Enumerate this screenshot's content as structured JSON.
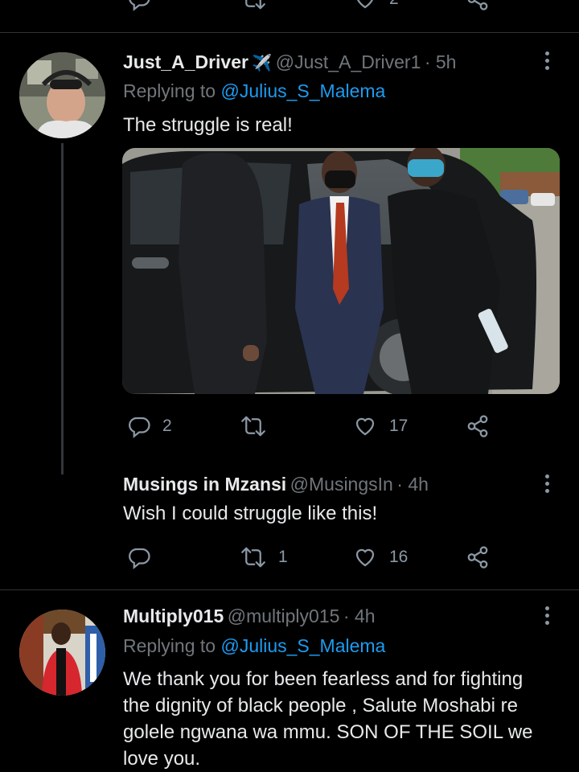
{
  "top_actions": {
    "likes": "2"
  },
  "tweet1": {
    "display_name": "Just_A_Driver",
    "badge": "✈️",
    "handle": "@Just_A_Driver1",
    "time": "· 5h",
    "replying_prefix": "Replying to",
    "replying_to": "@Julius_S_Malema",
    "text": "The struggle is real!",
    "replies": "2",
    "retweets": "",
    "likes": "17"
  },
  "tweet2": {
    "display_name": "Musings in Mzansi",
    "handle": "@MusingsIn",
    "time": "· 4h",
    "text": "Wish I could struggle like this!",
    "replies": "",
    "retweets": "1",
    "likes": "16"
  },
  "tweet3": {
    "display_name": "Multiply015",
    "handle": "@multiply015",
    "time": "· 4h",
    "replying_prefix": "Replying to",
    "replying_to": "@Julius_S_Malema",
    "text": "We thank you for been fearless and for fighting the dignity of black people , Salute Moshabi re golele ngwana wa mmu. SON OF THE SOIL we love you."
  },
  "icons": {
    "reply": "reply-icon",
    "retweet": "retweet-icon",
    "like": "heart-icon",
    "share": "share-icon",
    "more": "more-icon"
  },
  "colors": {
    "background": "#000000",
    "link": "#1d9bf0",
    "muted": "#71767b"
  }
}
